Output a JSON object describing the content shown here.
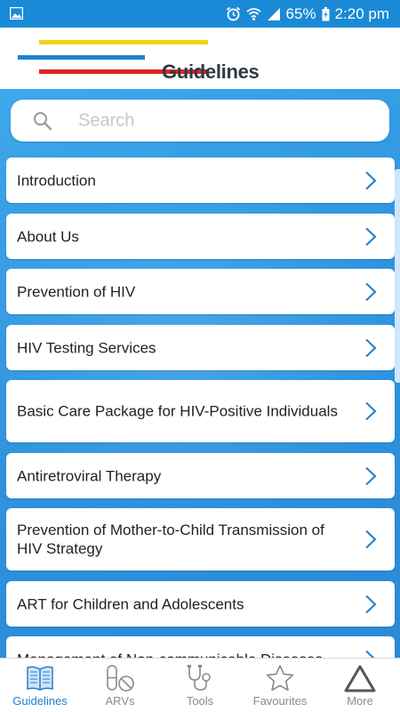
{
  "status_bar": {
    "battery": "65%",
    "time": "2:20 pm"
  },
  "header": {
    "title": "Guidelines"
  },
  "search": {
    "placeholder": "Search"
  },
  "list": {
    "items": [
      {
        "label": "Introduction"
      },
      {
        "label": "About Us"
      },
      {
        "label": "Prevention of HIV"
      },
      {
        "label": "HIV Testing Services"
      },
      {
        "label": "Basic Care Package for HIV-Positive Individuals"
      },
      {
        "label": "Antiretroviral Therapy"
      },
      {
        "label": "Prevention of Mother-to-Child Transmission of HIV Strategy"
      },
      {
        "label": "ART for Children and Adolescents"
      },
      {
        "label": "Management of Non-communicable Diseases"
      }
    ]
  },
  "tabbar": {
    "tabs": [
      {
        "label": "Guidelines",
        "icon": "book-icon",
        "active": true
      },
      {
        "label": "ARVs",
        "icon": "pills-icon",
        "active": false
      },
      {
        "label": "Tools",
        "icon": "stethoscope-icon",
        "active": false
      },
      {
        "label": "Favourites",
        "icon": "star-icon",
        "active": false
      },
      {
        "label": "More",
        "icon": "triangle-icon",
        "active": false
      }
    ]
  },
  "colors": {
    "status_bar": "#1a8ad6",
    "accent": "#1a7fd0",
    "logo_yellow": "#f3d319",
    "logo_blue": "#1d82d1",
    "logo_red": "#e12424"
  }
}
